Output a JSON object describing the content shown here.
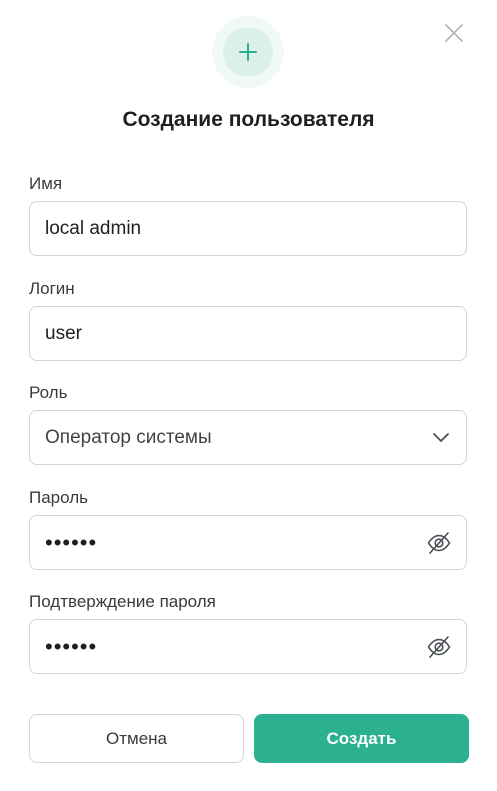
{
  "dialog": {
    "title": "Создание пользователя",
    "accent_color": "#2bb190",
    "header_icon": "plus-icon",
    "close_icon": "close-icon"
  },
  "fields": {
    "name": {
      "label": "Имя",
      "value": "local admin"
    },
    "login": {
      "label": "Логин",
      "value": "user"
    },
    "role": {
      "label": "Роль",
      "value": "Оператор системы",
      "icon": "chevron-down-icon"
    },
    "password": {
      "label": "Пароль",
      "value": "••••••",
      "icon": "eye-off-icon"
    },
    "confirm": {
      "label": "Подтверждение пароля",
      "value": "••••••",
      "icon": "eye-off-icon"
    }
  },
  "buttons": {
    "cancel": "Отмена",
    "create": "Создать"
  }
}
